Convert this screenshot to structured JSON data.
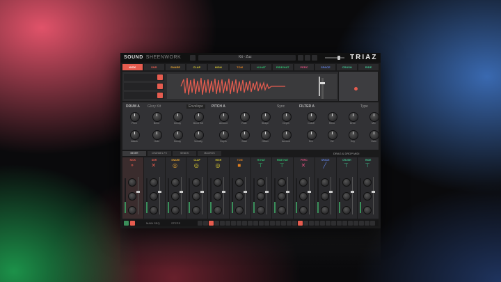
{
  "app": {
    "brand": "SOUND",
    "brand_sub": "SHEENWORK",
    "logo": "TRIAZ",
    "preset_name": "Kit - Zuz"
  },
  "sound_tabs": [
    {
      "label": "KICK",
      "color": "#e65c4f",
      "active": true
    },
    {
      "label": "SNR",
      "color": "#e65c4f"
    },
    {
      "label": "SNARE",
      "color": "#e0a030"
    },
    {
      "label": "CLAP",
      "color": "#d8c830"
    },
    {
      "label": "HIGH",
      "color": "#d8c830"
    },
    {
      "label": "TOM",
      "color": "#e08020"
    },
    {
      "label": "HI HAT",
      "color": "#30c070"
    },
    {
      "label": "RIDE/HAT",
      "color": "#30c070"
    },
    {
      "label": "PERC",
      "color": "#e05080"
    },
    {
      "label": "SPACE",
      "color": "#6080e0"
    },
    {
      "label": "CRUSH",
      "color": "#40c090"
    },
    {
      "label": "RIDE",
      "color": "#40c090"
    }
  ],
  "wave_rows": [
    "1",
    "2",
    "3"
  ],
  "sections": {
    "drum": "DRUM A",
    "drum_mode": "Glory Kit",
    "pitch": "PITCH A",
    "filter": "FILTER A",
    "drum_btn": "Envelope",
    "pitch_sync": "Sync",
    "filter_type": "Type"
  },
  "knobs_row1": [
    "Pitch",
    "Bend",
    "Decay",
    "Bend Rel",
    "Amount",
    "Rate",
    "Shape",
    "Depth",
    "Cutoff",
    "Reso",
    "Drive",
    "Mix"
  ],
  "knobs_row2": [
    "Attack",
    "Hold",
    "Decay",
    "Velocity",
    "Depth",
    "Start",
    "Offset",
    "Amount",
    "Env",
    "Vel",
    "Key",
    "Gain"
  ],
  "mixer_tabs": [
    {
      "label": "MIXER",
      "active": true
    },
    {
      "label": "CHANNEL FX"
    },
    {
      "label": "SENDS"
    },
    {
      "label": "MACROS"
    }
  ],
  "drag_drop": "DRAG & DROP MIDI",
  "channels": [
    {
      "name": "KICK",
      "icon": "⚬",
      "color": "#e65c4f",
      "active": true
    },
    {
      "name": "SNR",
      "icon": "✕",
      "color": "#e65c4f"
    },
    {
      "name": "SNARE",
      "icon": "◎",
      "color": "#e0a030"
    },
    {
      "name": "CLAP",
      "icon": "◎",
      "color": "#d8c830"
    },
    {
      "name": "HIGH",
      "icon": "◎",
      "color": "#d8c830"
    },
    {
      "name": "TOM",
      "icon": "■",
      "color": "#e08020"
    },
    {
      "name": "HI HAT",
      "icon": "⊤",
      "color": "#30c070"
    },
    {
      "name": "RIDE HAT",
      "icon": "⊤",
      "color": "#30c070"
    },
    {
      "name": "PERC",
      "icon": "✕",
      "color": "#e05080"
    },
    {
      "name": "SPACE",
      "icon": "╱",
      "color": "#6080e0"
    },
    {
      "name": "CRUSH",
      "icon": "⊤",
      "color": "#40c090"
    },
    {
      "name": "RIDE",
      "icon": "⊤",
      "color": "#40c090"
    }
  ],
  "sequencer": {
    "label_a": "MAIN SEQ",
    "label_b": "STEPS",
    "steps": 32,
    "active_steps": [
      2,
      18
    ]
  }
}
